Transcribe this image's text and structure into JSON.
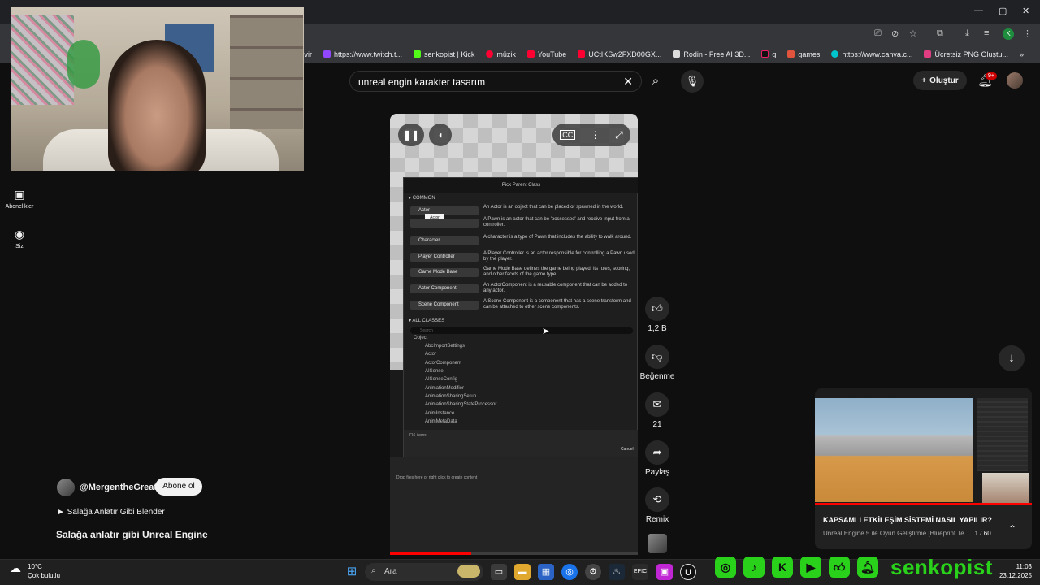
{
  "bookmarks": [
    {
      "label": "Çevir",
      "color": "#4285f4"
    },
    {
      "label": "https://www.twitch.t...",
      "color": "#9146ff"
    },
    {
      "label": "senkopist | Kick",
      "color": "#53fc18"
    },
    {
      "label": "müzik",
      "color": "#ff0033"
    },
    {
      "label": "YouTube",
      "color": "#ff0033"
    },
    {
      "label": "UCtIKSw2FXD00GX...",
      "color": "#ff0033"
    },
    {
      "label": "Rodin - Free AI 3D...",
      "color": "#dddddd"
    },
    {
      "label": "g",
      "color": "#111111"
    },
    {
      "label": "games",
      "color": "#e0533d"
    },
    {
      "label": "https://www.canva.c...",
      "color": "#00c4cc"
    },
    {
      "label": "Ücretsiz PNG Oluştu...",
      "color": "#e13d82"
    }
  ],
  "youtube": {
    "search_value": "unreal engin karakter tasarım",
    "create_label": "Oluştur",
    "notif_badge": "9+",
    "sidebar": {
      "subs": "Abonelikler",
      "you": "Siz"
    }
  },
  "ue": {
    "dialog_title": "Pick Parent Class",
    "common_header": "COMMON",
    "tooltip": "Actor",
    "common": [
      {
        "label": "Actor",
        "desc": "An Actor is an object that can be placed or spawned in the world."
      },
      {
        "label": "",
        "desc": "A Pawn is an actor that can be 'possessed' and receive input from a controller."
      },
      {
        "label": "Character",
        "desc": "A character is a type of Pawn that includes the ability to walk around."
      },
      {
        "label": "Player Controller",
        "desc": "A Player Controller is an actor responsible for controlling a Pawn used by the player."
      },
      {
        "label": "Game Mode Base",
        "desc": "Game Mode Base defines the game being played, its rules, scoring, and other facets of the game type."
      },
      {
        "label": "Actor Component",
        "desc": "An ActorComponent is a reusable component that can be added to any actor."
      },
      {
        "label": "Scene Component",
        "desc": "A Scene Component is a component that has a scene transform and can be attached to other scene components."
      }
    ],
    "all_header": "ALL CLASSES",
    "search_placeholder": "Search",
    "tree": [
      "Object",
      "AbcImportSettings",
      "Actor",
      "ActorComponent",
      "AISense",
      "AISenseConfig",
      "AnimationModifier",
      "AnimationSharingSetup",
      "AnimationSharingStateProcessor",
      "AnimInstance",
      "AnimMetaData"
    ],
    "items_count": "716 items",
    "cancel": "Cancel",
    "drop_hint": "Drop files here or right click to create content"
  },
  "actions": {
    "likes": "1,2 B",
    "dislike": "Beğenme",
    "comments": "21",
    "share": "Paylaş",
    "remix": "Remix"
  },
  "channel": {
    "name": "@MergentheGreat",
    "subscribe": "Abone ol",
    "playlist": "► Salağa Anlatır Gibi Blender",
    "title": "Salağa anlatır gibi Unreal Engine"
  },
  "recommendation": {
    "title": "KAPSAMLI ETKİLEŞİM SİSTEMİ NASIL YAPILIR?",
    "subtitle": "Unreal Engine 5 ile Oyun Geliştirme [Blueprint Te...",
    "position": "1 / 60"
  },
  "taskbar": {
    "weather_temp": "10°C",
    "weather_desc": "Çok bulutlu",
    "search": "Ara",
    "time": "11:03",
    "date": "23.12.2025",
    "brand": "senkopist"
  }
}
